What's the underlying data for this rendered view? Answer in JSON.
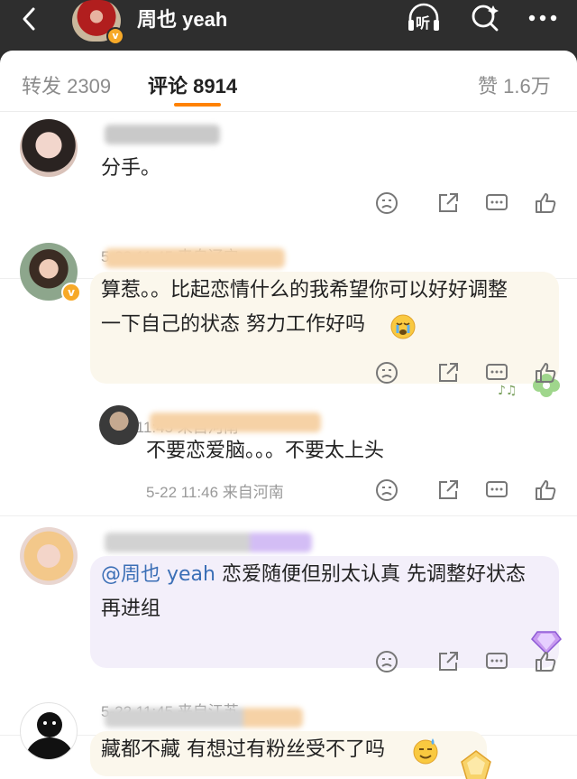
{
  "header": {
    "title": "周也 yeah",
    "verified_badge": "v",
    "icons": [
      "back-arrow-icon",
      "listen-icon",
      "search-icon",
      "more-icon"
    ],
    "listen_label": "听"
  },
  "tabs": [
    {
      "label": "转发",
      "count": "2309",
      "active": false
    },
    {
      "label": "评论",
      "count": "8914",
      "active": true
    },
    {
      "label": "赞",
      "count": "1.6万",
      "active": false
    }
  ],
  "accent_color": "#ff8200",
  "comments": [
    {
      "text": "分手。",
      "meta": "5-22 11:45  来自辽宁",
      "actions": [
        "dislike-icon",
        "share-icon",
        "comment-icon",
        "like-icon"
      ]
    },
    {
      "text_line1": "算惹。。比起恋情什么的我希望你可以好好调整",
      "text_line2": "一下自己的状态 努力工作好吗",
      "meta": "5-22 11:45  来自河南",
      "verified": "v"
    },
    {
      "reply": true,
      "text": "不要恋爱脑。。。不要太上头",
      "meta": "5-22 11:46  来自河南"
    },
    {
      "mention": "@周也 yeah",
      "text_line1_rest": " 恋爱随便但别太认真 先调整好状态",
      "text_line2": "再进组",
      "meta": "5-22 11:45  来自江苏"
    },
    {
      "text": "藏都不藏 有想过有粉丝受不了吗"
    }
  ]
}
